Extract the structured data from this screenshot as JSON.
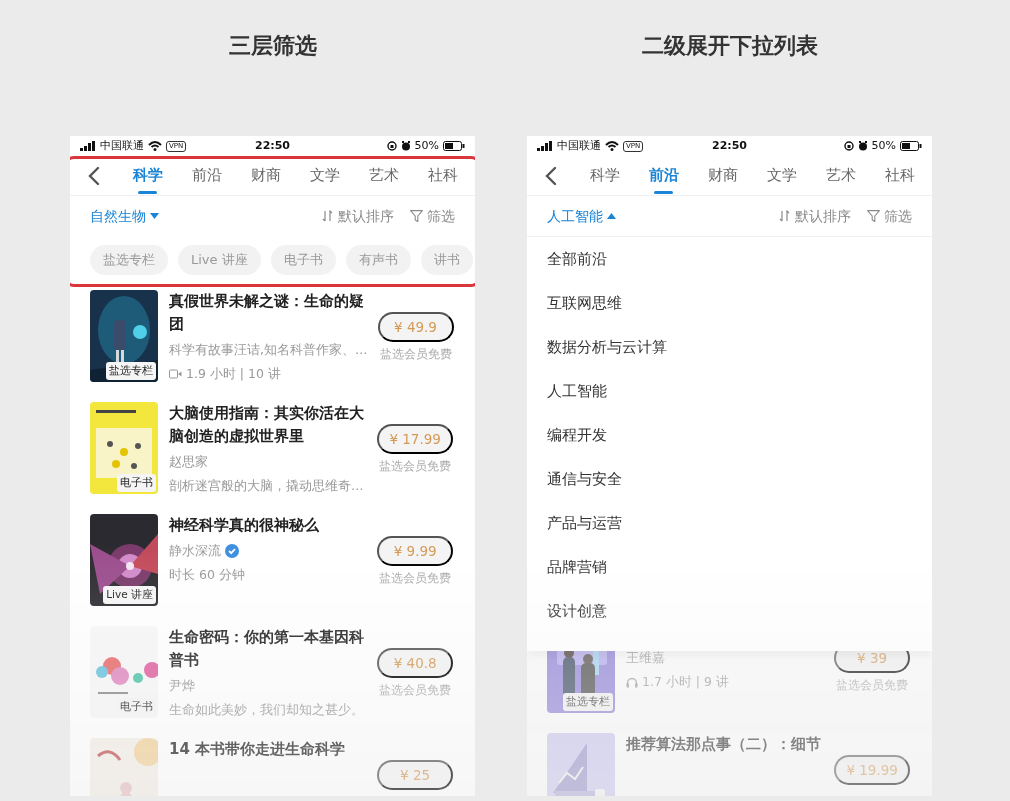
{
  "panels": [
    {
      "heading": "三层筛选",
      "highlighted": true,
      "status_bar": {
        "carrier": "中国联通",
        "vpn": "VPN",
        "time": "22:50",
        "battery": "50%"
      },
      "tabs": [
        {
          "label": "科学",
          "selected": true
        },
        {
          "label": "前沿",
          "selected": false
        },
        {
          "label": "财商",
          "selected": false
        },
        {
          "label": "文学",
          "selected": false
        },
        {
          "label": "艺术",
          "selected": false
        },
        {
          "label": "社科",
          "selected": false
        }
      ],
      "filter": {
        "category": "自然生物",
        "expanded": false,
        "sort": "默认排序",
        "filter": "筛选"
      },
      "chips": [
        "盐选专栏",
        "Live 讲座",
        "电子书",
        "有声书",
        "讲书"
      ],
      "items": [
        {
          "title": "真假世界未解之谜：生命的疑团",
          "badge": "盐选专栏",
          "price": "¥ 49.9",
          "member": "盐选会员免费",
          "lines": [
            {
              "kind": "text",
              "text": "科学有故事汪诘,知名科普作家、…"
            },
            {
              "kind": "video",
              "text": "1.9 小时 | 10 讲"
            }
          ]
        },
        {
          "title": "大脑使用指南：其实你活在大脑创造的虚拟世界里",
          "badge": "电子书",
          "price": "¥ 17.99",
          "member": "盐选会员免费",
          "lines": [
            {
              "kind": "text",
              "text": "赵思家"
            },
            {
              "kind": "text",
              "text": "剖析迷宫般的大脑，撬动思维奇…"
            }
          ]
        },
        {
          "title": "神经科学真的很神秘么",
          "badge": "Live 讲座",
          "price": "¥ 9.99",
          "member": "盐选会员免费",
          "lines": [
            {
              "kind": "verified",
              "text": "静水深流"
            },
            {
              "kind": "text",
              "text": "时长 60 分钟"
            }
          ]
        },
        {
          "title": "生命密码：你的第一本基因科普书",
          "badge": "电子书",
          "price": "¥ 40.8",
          "member": "盐选会员免费",
          "lines": [
            {
              "kind": "text",
              "text": "尹烨"
            },
            {
              "kind": "text",
              "text": "生命如此美妙，我们却知之甚少。"
            }
          ]
        },
        {
          "title": "14 本书带你走进生命科学",
          "price": "¥ 25"
        }
      ]
    },
    {
      "heading": "二级展开下拉列表",
      "status_bar": {
        "carrier": "中国联通",
        "vpn": "VPN",
        "time": "22:50",
        "battery": "50%"
      },
      "tabs": [
        {
          "label": "科学",
          "selected": false
        },
        {
          "label": "前沿",
          "selected": true
        },
        {
          "label": "财商",
          "selected": false
        },
        {
          "label": "文学",
          "selected": false
        },
        {
          "label": "艺术",
          "selected": false
        },
        {
          "label": "社科",
          "selected": false
        }
      ],
      "filter": {
        "category": "人工智能",
        "expanded": true,
        "sort": "默认排序",
        "filter": "筛选"
      },
      "dropdown": [
        "全部前沿",
        "互联网思维",
        "数据分析与云计算",
        "人工智能",
        "编程开发",
        "通信与安全",
        "产品与运营",
        "品牌营销",
        "设计创意"
      ],
      "items": [
        {
          "badge": "盐选专栏",
          "price": "¥ 39",
          "member": "盐选会员免费",
          "lines": [
            {
              "kind": "text",
              "text": "王维嘉"
            },
            {
              "kind": "audio",
              "text": "1.7 小时 | 9 讲"
            }
          ]
        },
        {
          "title": "推荐算法那点事（二）：细节",
          "price": "¥ 19.99"
        }
      ]
    }
  ]
}
